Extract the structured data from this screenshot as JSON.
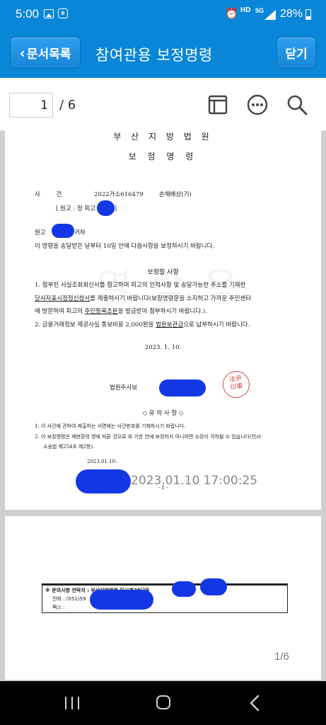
{
  "status_bar": {
    "time": "5:00",
    "network_hd": "HD",
    "network_5g": "5G",
    "battery": "28%"
  },
  "header": {
    "back_label": "문서목록",
    "title": "참여관용 보정명령",
    "close_label": "닫기"
  },
  "toolbar": {
    "page_current": "1",
    "page_total": "/ 6",
    "icons": [
      "layout-icon",
      "more-icon",
      "search-icon"
    ]
  },
  "document": {
    "court": "부 산 지 방 법 원",
    "title": "보 정 명 령",
    "case_label": "사 건",
    "case_number": "2022가소616479",
    "case_type": "손해배상(기)",
    "parties": "[ 원고 : 정       피고 : 모름 ]",
    "addressee_prefix": "원고",
    "addressee_suffix": "귀하",
    "intro": "이 명령을 송달받은 날부터  10일 안에 다음사항을 보정하시기 바랍니다.",
    "section_head": "보정할 사항",
    "item1_line1": "1. 첨부된 사실조회회신서를 참고하여 피고의 인적사항 및 송달가능한 주소를 기재한",
    "item1_line2_ul": "당사자표시정정신청서",
    "item1_line2_rest": "를 제출하시기 바랍니다(보정명령문을 소지하고 가까운 주민센터",
    "item1_line3_a": "에 방문하여 피고의 ",
    "item1_line3_ul": "주민등록초본",
    "item1_line3_b": "을 발급받아 첨부하시기 바랍니다.).",
    "item2_a": "2. 금융거래정보 제공사실 통보비용 2,000원을 ",
    "item2_ul": "법원보관금",
    "item2_b": "으로 납부하시기 바랍니다.",
    "date": "2023.  1.  10.",
    "signer": "법원주사보",
    "notes_head": "◇ 유 의 사 항 ◇",
    "note1": "1. 이 사건에 관하여 제출하는 서면에는 사건번호를 기재하시기 바랍니다.",
    "note2": "2. 이 보정명령은 재판장의 명에 따른 것으로 위 기한 안에 보정하지 아니하면 소장이 각하될 수 있습니다(민사",
    "note3": "소송법 제254조 제2항).",
    "note4": "2023.01.10.",
    "timestamp": "2023.01.10 17:00:25",
    "page_no": "- 1 -",
    "watermark": "열 람 용",
    "seal_text": "法尹\n印事"
  },
  "page2": {
    "contact_line1": "※ 문의사항 연락처 : 부산지방법원   민사제28단독",
    "contact_line2": "전화 : (051)59",
    "contact_line3": "팩스 :",
    "page_indicator": "1/6"
  },
  "colors": {
    "brand_blue": "#0a86d8",
    "redaction_blue": "#1437e6",
    "seal_red": "#d7474a"
  }
}
